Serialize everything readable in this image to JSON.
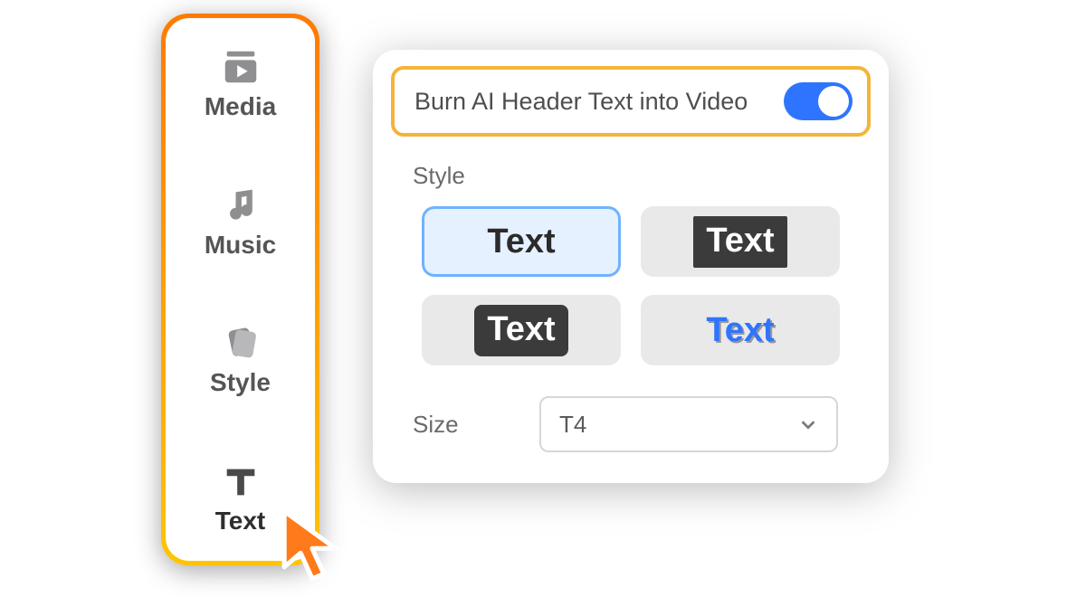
{
  "sidebar": {
    "items": [
      {
        "label": "Media",
        "icon": "media-icon"
      },
      {
        "label": "Music",
        "icon": "music-icon"
      },
      {
        "label": "Style",
        "icon": "style-icon"
      },
      {
        "label": "Text",
        "icon": "text-icon"
      }
    ],
    "active_index": 3
  },
  "panel": {
    "toggle": {
      "label": "Burn AI Header Text into Video",
      "on": true
    },
    "style": {
      "label": "Style",
      "options": [
        {
          "label": "Text",
          "variant": "plain",
          "selected": true
        },
        {
          "label": "Text",
          "variant": "dark",
          "selected": false
        },
        {
          "label": "Text",
          "variant": "darkWhite",
          "selected": false
        },
        {
          "label": "Text",
          "variant": "blue",
          "selected": false
        }
      ]
    },
    "size": {
      "label": "Size",
      "value": "T4"
    }
  },
  "colors": {
    "accent_orange": "#ff7a00",
    "accent_yellow": "#ffc400",
    "accent_blue": "#2f74ff"
  }
}
